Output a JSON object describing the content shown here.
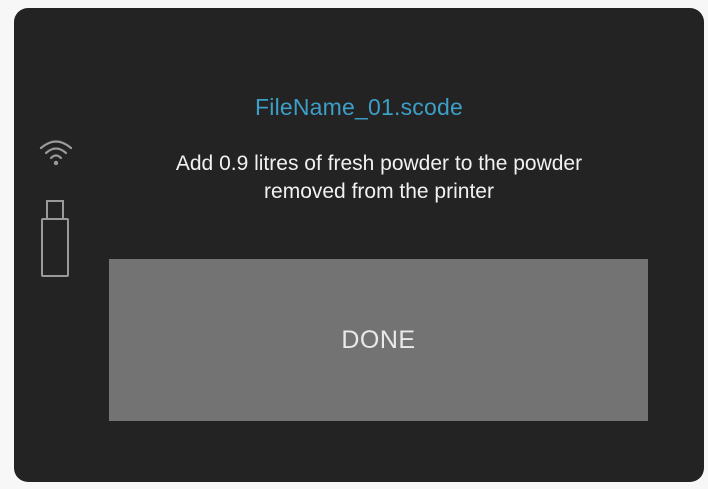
{
  "dialog": {
    "filename": "FileName_01.scode",
    "message": "Add 0.9 litres of fresh powder to the powder removed from the printer",
    "done_label": "DONE"
  },
  "status_icons": [
    "wifi-icon",
    "usb-drive-icon"
  ],
  "colors": {
    "screen_background": "#232323",
    "filename_text": "#3d9ec8",
    "message_text": "#f1f1f1",
    "button_background": "#737373",
    "button_text": "#e9e9e9",
    "icon_stroke": "#9a9a9a"
  }
}
